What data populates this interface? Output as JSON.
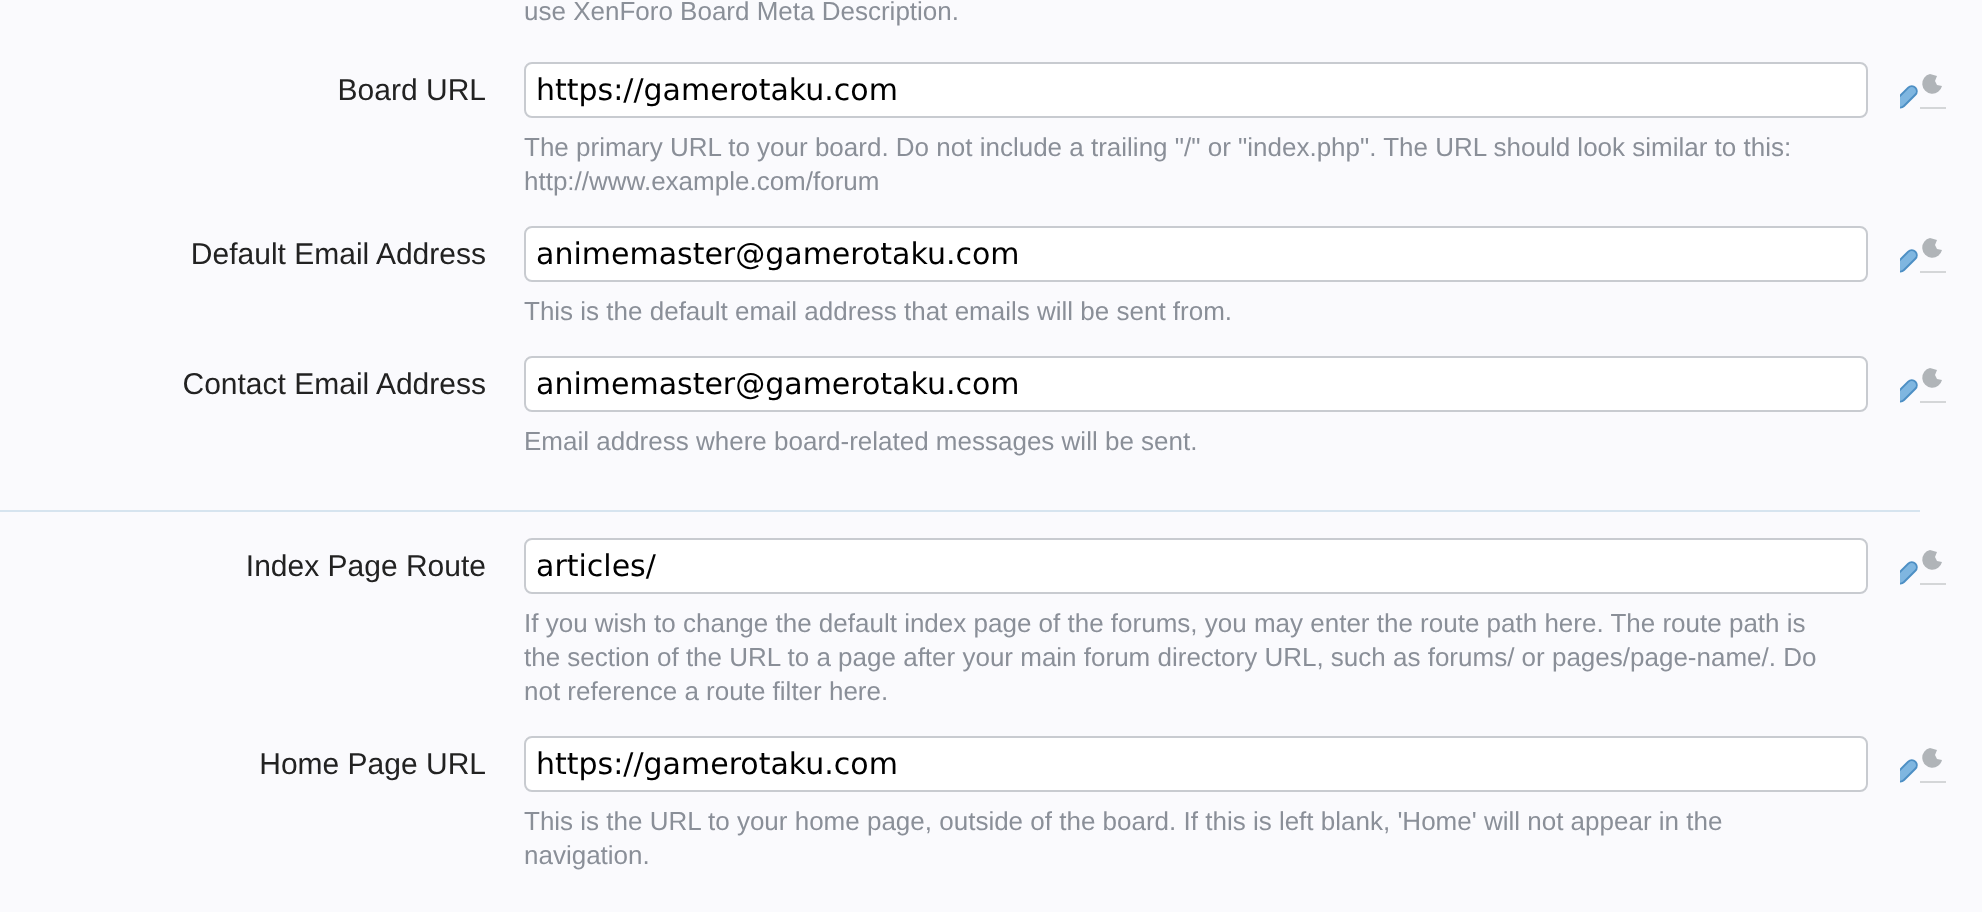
{
  "top_hint": "use XenForo Board Meta Description.",
  "groups": [
    {
      "options": [
        {
          "label": "Board URL",
          "value": "https://gamerotaku.com",
          "hint": "The primary URL to your board. Do not include a trailing \"/\" or \"index.php\". The URL should look similar to this: http://www.example.com/forum"
        },
        {
          "label": "Default Email Address",
          "value": "animemaster@gamerotaku.com",
          "hint": "This is the default email address that emails will be sent from."
        },
        {
          "label": "Contact Email Address",
          "value": "animemaster@gamerotaku.com",
          "hint": "Email address where board-related messages will be sent."
        }
      ]
    },
    {
      "options": [
        {
          "label": "Index Page Route",
          "value": "articles/",
          "hint": "If you wish to change the default index page of the forums, you may enter the route path here. The route path is the section of the URL to a page after your main forum directory URL, such as forums/ or pages/page-name/. Do not reference a route filter here."
        },
        {
          "label": "Home Page URL",
          "value": "https://gamerotaku.com",
          "hint": "This is the URL to your home page, outside of the board. If this is left blank, 'Home' will not appear in the navigation."
        }
      ]
    }
  ]
}
